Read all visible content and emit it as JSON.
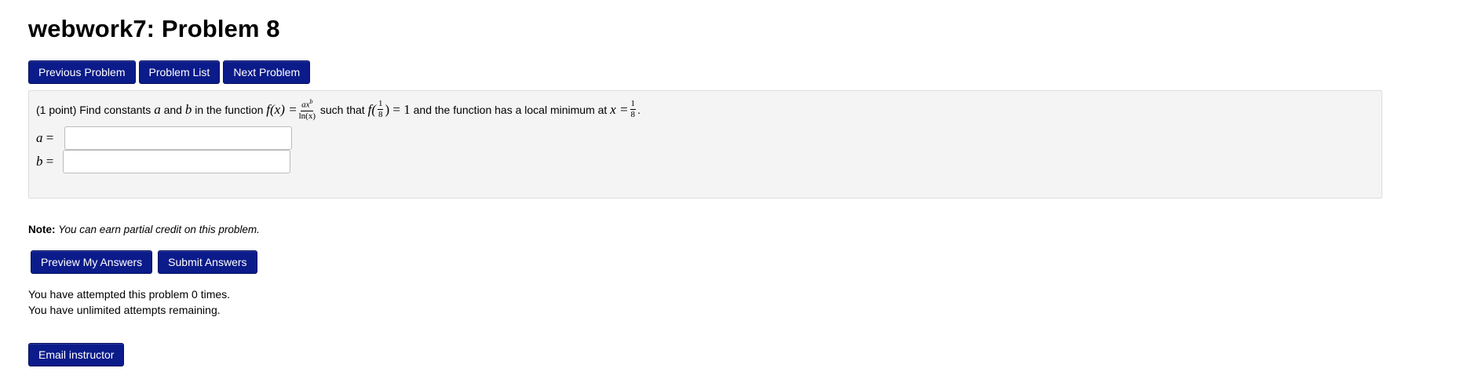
{
  "page": {
    "title": "webwork7: Problem 8"
  },
  "nav": {
    "previous_label": "Previous Problem",
    "list_label": "Problem List",
    "next_label": "Next Problem"
  },
  "problem": {
    "intro": "(1 point) Find constants",
    "var_a": "a",
    "and_text": "and",
    "var_b": "b",
    "in_function_text": "in the function",
    "f_lhs": "f(x) =",
    "frac_numerator": "ax",
    "frac_numerator_exp": "b",
    "frac_denominator": "ln(x)",
    "such_that_text": "such that",
    "f_at": "f(",
    "half_num": "1",
    "half_den": "8",
    "f_close": ") = 1",
    "local_min_text": "and the function has a local minimum at",
    "x_eq": "x =",
    "min_num": "1",
    "min_den": "8",
    "period": "."
  },
  "answers": {
    "a_label": "a",
    "b_label": "b",
    "equals": "=",
    "a_value": "",
    "b_value": ""
  },
  "note": {
    "label": "Note:",
    "text": "You can earn partial credit on this problem."
  },
  "actions": {
    "preview_label": "Preview My Answers",
    "submit_label": "Submit Answers"
  },
  "attempts": {
    "line1": "You have attempted this problem 0 times.",
    "line2": "You have unlimited attempts remaining."
  },
  "email": {
    "label": "Email instructor"
  },
  "colors": {
    "button_bg": "#0b1b8a",
    "problem_bg": "#f4f4f4"
  }
}
